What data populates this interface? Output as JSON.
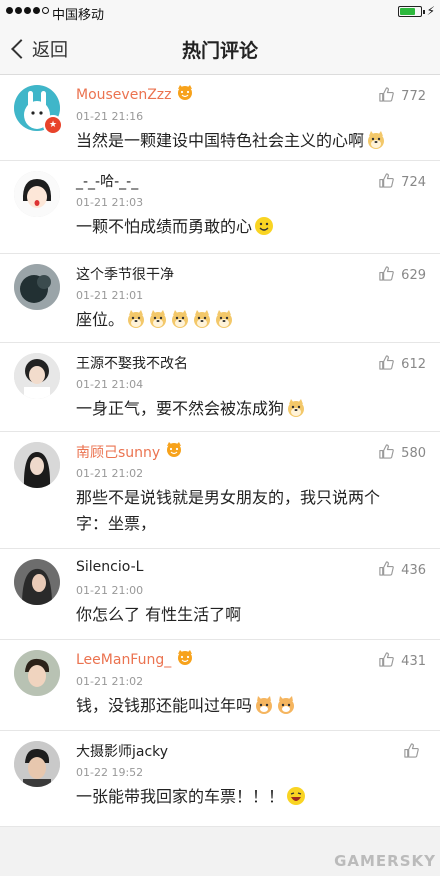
{
  "status_bar": {
    "carrier": "中国移动",
    "battery_color": "#2db83d",
    "battery_level": 0.75
  },
  "nav": {
    "back_label": "返回",
    "title": "热门评论"
  },
  "comments": [
    {
      "name": "MousevenZzz",
      "vip": true,
      "time": "01-21 21:16",
      "text": "当然是一颗建设中国特色社会主义的心啊",
      "emoji": [
        "doge"
      ],
      "likes": "772"
    },
    {
      "name": "_-_-哈-_-_",
      "vip": false,
      "time": "01-21 21:03",
      "text": "一颗不怕成绩而勇敢的心",
      "emoji": [
        "smile"
      ],
      "likes": "724"
    },
    {
      "name": "这个季节很干净",
      "vip": false,
      "time": "01-21 21:01",
      "text": "座位。",
      "emoji": [
        "doge",
        "doge",
        "doge",
        "doge",
        "doge"
      ],
      "likes": "629"
    },
    {
      "name": "王源不娶我不改名",
      "vip": false,
      "time": "01-21 21:04",
      "text": "一身正气，要不然会被冻成狗",
      "emoji": [
        "doge"
      ],
      "likes": "612"
    },
    {
      "name": "南顾己sunny",
      "vip": true,
      "time": "01-21 21:02",
      "text": "那些不是说钱就是男女朋友的，我只说两个字：坐票，",
      "emoji": [],
      "likes": "580"
    },
    {
      "name": "Silencio-L",
      "vip": false,
      "time": "01-21 21:00",
      "text": "你怎么了 有性生活了啊",
      "emoji": [],
      "likes": "436"
    },
    {
      "name": "LeeManFung_",
      "vip": true,
      "time": "01-21 21:02",
      "text": "钱，没钱那还能叫过年吗",
      "emoji": [
        "cat",
        "cat"
      ],
      "likes": "431"
    },
    {
      "name": "大摄影师jacky",
      "vip": false,
      "time": "01-22 19:52",
      "text": "一张能带我回家的车票！！！",
      "emoji": [
        "laugh"
      ],
      "likes": ""
    }
  ],
  "watermark": "GAMERSKY"
}
